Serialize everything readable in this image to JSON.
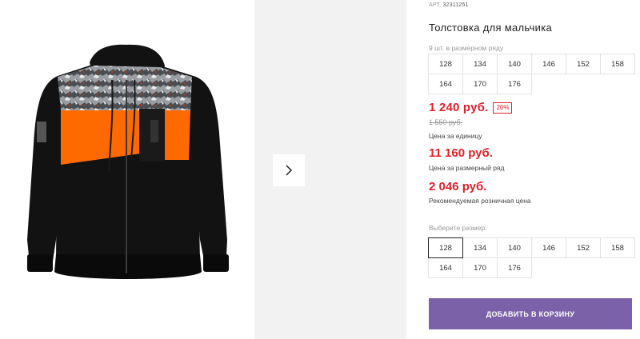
{
  "product": {
    "art_label": "АРТ.",
    "art_number": "32311251",
    "title": "Толстовка для мальчика",
    "pack_note": "9 шт. в размерном ряду",
    "pack_sizes": [
      "128",
      "134",
      "140",
      "146",
      "152",
      "158",
      "164",
      "170",
      "176"
    ],
    "price": "1 240 руб.",
    "discount": "20%",
    "old_price": "1 550 руб.",
    "price_caption": "Цена за единицу",
    "pack_price": "11 160 руб.",
    "pack_price_caption": "Цена за размерный ряд",
    "retail_price": "2 046 руб.",
    "retail_price_caption": "Рекомендуемая розничная цена",
    "choose_size_label": "Выберите размер:",
    "selectable_sizes": [
      "128",
      "134",
      "140",
      "146",
      "152",
      "158",
      "164",
      "170",
      "176"
    ],
    "selected_size": "128",
    "add_to_cart_label": "ДОБАВИТЬ В КОРЗИНУ"
  },
  "gallery": {
    "next_icon": "chevron-right-icon"
  },
  "colors": {
    "accent_red": "#e0212b",
    "button_purple": "#7b62a8",
    "jacket_orange": "#ff6a00",
    "jacket_black": "#111111"
  }
}
